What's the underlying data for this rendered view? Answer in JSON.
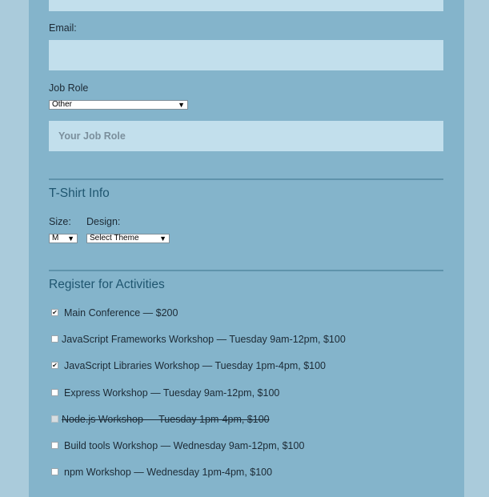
{
  "form": {
    "email_label": "Email:",
    "email_value": "",
    "job_role_label": "Job Role",
    "job_role_selected": "Other",
    "job_role_placeholder": "Your Job Role"
  },
  "tshirt": {
    "title": "T-Shirt Info",
    "size_label": "Size:",
    "size_selected": "M",
    "design_label": "Design:",
    "design_selected": "Select Theme"
  },
  "activities": {
    "title": "Register for Activities",
    "items": [
      {
        "label": "Main Conference — $200",
        "checked": true,
        "disabled": false
      },
      {
        "label": "JavaScript Frameworks Workshop — Tuesday 9am-12pm, $100",
        "checked": false,
        "disabled": false
      },
      {
        "label": "JavaScript Libraries Workshop — Tuesday 1pm-4pm, $100",
        "checked": true,
        "disabled": false
      },
      {
        "label": "Express Workshop — Tuesday 9am-12pm, $100",
        "checked": false,
        "disabled": false
      },
      {
        "label": "Node.js Workshop — Tuesday 1pm-4pm, $100",
        "checked": false,
        "disabled": true
      },
      {
        "label": "Build tools Workshop — Wednesday 9am-12pm, $100",
        "checked": false,
        "disabled": false
      },
      {
        "label": "npm Workshop — Wednesday 1pm-4pm, $100",
        "checked": false,
        "disabled": false
      }
    ]
  },
  "icons": {
    "select_arrow": "triangle-down-icon",
    "check": "checkmark-icon"
  },
  "colors": {
    "page_background": "#aacbdb",
    "form_background": "#84b4cb",
    "input_background": "#c2dfec",
    "section_title": "#1f5670",
    "divider": "#5f93ab"
  }
}
